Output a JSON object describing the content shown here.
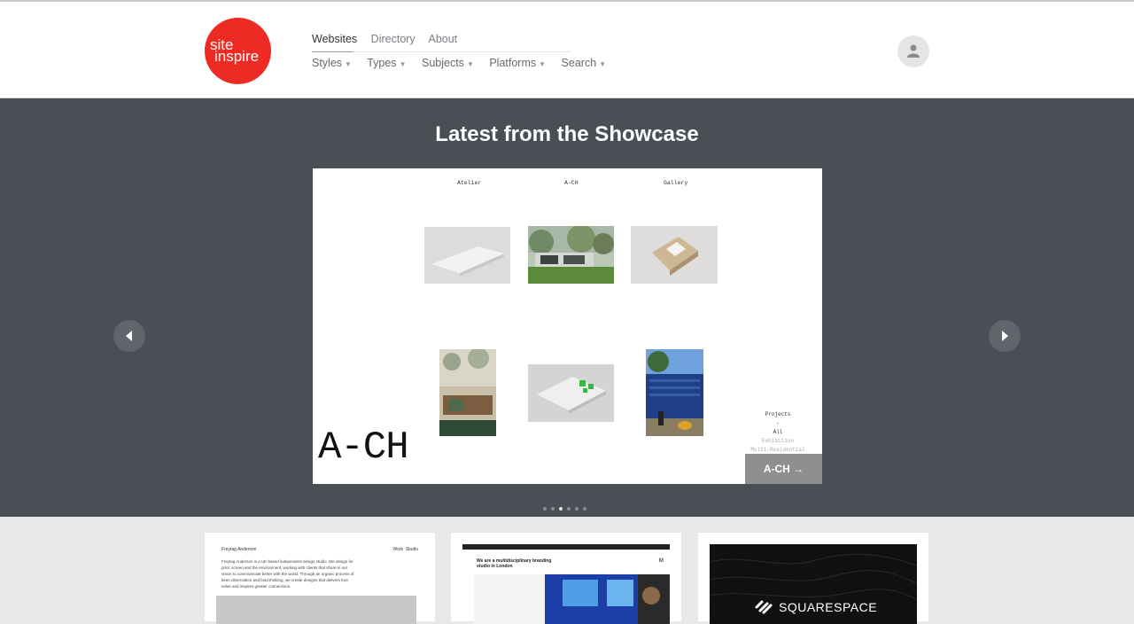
{
  "logo": {
    "line1": "site",
    "line2": "inspire"
  },
  "nav": {
    "top": [
      "Websites",
      "Directory",
      "About"
    ],
    "sub": [
      "Styles",
      "Types",
      "Subjects",
      "Platforms",
      "Search"
    ]
  },
  "showcase": {
    "title": "Latest from the Showcase",
    "slide": {
      "nav": [
        "Atelier",
        "A-CH",
        "Gallery"
      ],
      "big_label": "A-CH",
      "projects": [
        "Projects",
        "-",
        "All",
        "Exhibition",
        "Multi-Residential"
      ],
      "button": "A-CH →"
    },
    "dots": 6,
    "active_dot": 3
  },
  "cards": [
    {
      "title": "Freytag Anderson",
      "links": [
        "Work",
        "Studio"
      ],
      "text": "Freytag Anderson is a UK based independent design studio. We design for print, screen and the environment, working with clients that share in our vision to communicate better with the world. Through an organic process of keen observation and bold thinking, we create designs that delivers true value and inspires greater connections."
    },
    {
      "headline": "We are a multidisciplinary branding studio in London"
    },
    {
      "brand": "SQUARESPACE"
    }
  ]
}
